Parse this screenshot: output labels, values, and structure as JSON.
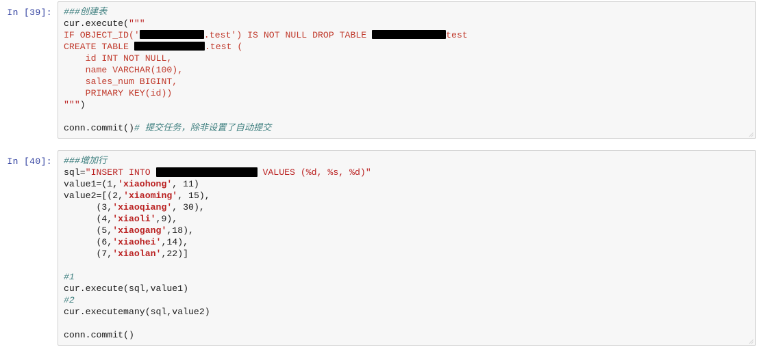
{
  "notebook": {
    "cells": [
      {
        "prompt": "In [39]:",
        "lines": {
          "l1": "###创建表",
          "l2_a": "cur.execute(",
          "l2_q": "\"\"\"",
          "l3_a": "IF OBJECT_ID('",
          "l3_b": ".test') IS NOT NULL DROP TABLE ",
          "l3_c": "test",
          "l4_a": "CREATE TABLE ",
          "l4_b": ".test (",
          "l5": "    id INT NOT NULL,",
          "l6": "    name VARCHAR(100),",
          "l7": "    sales_num BIGINT,",
          "l8": "    PRIMARY KEY(id))",
          "l9_q": "\"\"\"",
          "l9_b": ")",
          "l10": "",
          "l11_a": "conn.commit()",
          "l11_c": "# 提交任务，除非设置了自动提交"
        }
      },
      {
        "prompt": "In [40]:",
        "lines": {
          "l1": "###增加行",
          "l2_a": "sql=",
          "l2_b": "\"INSERT INTO ",
          "l2_c": " VALUES (%d, %s, %d)\"",
          "l3_a": "value1=(1,",
          "l3_s": "'xiaohong'",
          "l3_b": ", 11)",
          "l4_a": "value2=[(2,",
          "l4_s": "'xiaoming'",
          "l4_b": ", 15),",
          "l5_a": "      (3,",
          "l5_s": "'xiaoqiang'",
          "l5_b": ", 30),",
          "l6_a": "      (4,",
          "l6_s": "'xiaoli'",
          "l6_b": ",9),",
          "l7_a": "      (5,",
          "l7_s": "'xiaogang'",
          "l7_b": ",18),",
          "l8_a": "      (6,",
          "l8_s": "'xiaohei'",
          "l8_b": ",14),",
          "l9_a": "      (7,",
          "l9_s": "'xiaolan'",
          "l9_b": ",22)]",
          "l10": "",
          "l11": "#1",
          "l12": "cur.execute(sql,value1)",
          "l13": "#2",
          "l14": "cur.executemany(sql,value2)",
          "l15": "",
          "l16": "conn.commit()"
        }
      }
    ],
    "colors": {
      "prompt": "#303f9f",
      "comment": "#408080",
      "string": "#ba2121",
      "cell_bg": "#f7f7f7",
      "cell_border": "#cfcfcf",
      "redaction": "#000000"
    }
  }
}
